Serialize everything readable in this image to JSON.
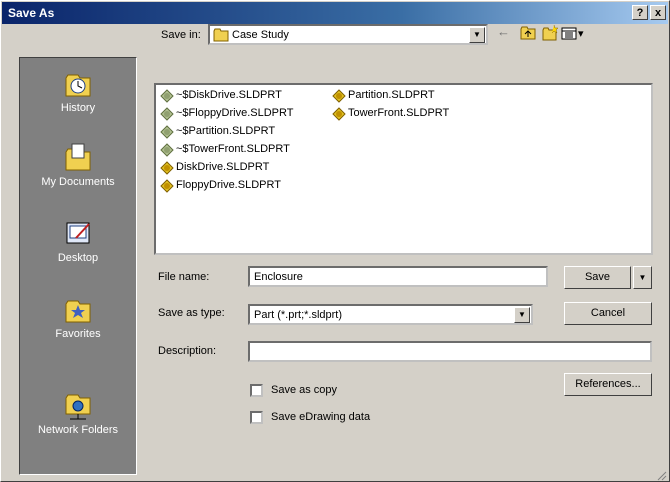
{
  "window": {
    "title": "Save As"
  },
  "titlebar_buttons": {
    "help": "?",
    "close": "x"
  },
  "places": [
    {
      "label": "History",
      "icon": "history-icon"
    },
    {
      "label": "My Documents",
      "icon": "my-documents-icon"
    },
    {
      "label": "Desktop",
      "icon": "desktop-icon"
    },
    {
      "label": "Favorites",
      "icon": "favorites-icon"
    },
    {
      "label": "Network Folders",
      "icon": "network-folders-icon"
    }
  ],
  "save_in": {
    "label": "Save in:",
    "value": "Case Study"
  },
  "toolbar": {
    "back": "←",
    "view_arrow": "▾"
  },
  "files": [
    {
      "name": "~$DiskDrive.SLDPRT",
      "temp": true
    },
    {
      "name": "~$FloppyDrive.SLDPRT",
      "temp": true
    },
    {
      "name": "~$Partition.SLDPRT",
      "temp": true
    },
    {
      "name": "~$TowerFront.SLDPRT",
      "temp": true
    },
    {
      "name": "DiskDrive.SLDPRT",
      "temp": false
    },
    {
      "name": "FloppyDrive.SLDPRT",
      "temp": false
    },
    {
      "name": "Partition.SLDPRT",
      "temp": false
    },
    {
      "name": "TowerFront.SLDPRT",
      "temp": false
    }
  ],
  "form": {
    "file_name_label": "File name:",
    "file_name_value": "Enclosure",
    "save_type_label": "Save as type:",
    "save_type_value": "Part (*.prt;*.sldprt)",
    "description_label": "Description:",
    "description_value": ""
  },
  "buttons": {
    "save": "Save",
    "cancel": "Cancel",
    "references": "References..."
  },
  "options": {
    "save_as_copy": "Save as copy",
    "save_edrawing": "Save eDrawing data"
  },
  "colors": {
    "title_start": "#0a246a",
    "title_end": "#a6caf0",
    "face": "#d4d0c8",
    "places_bg": "#808080"
  }
}
